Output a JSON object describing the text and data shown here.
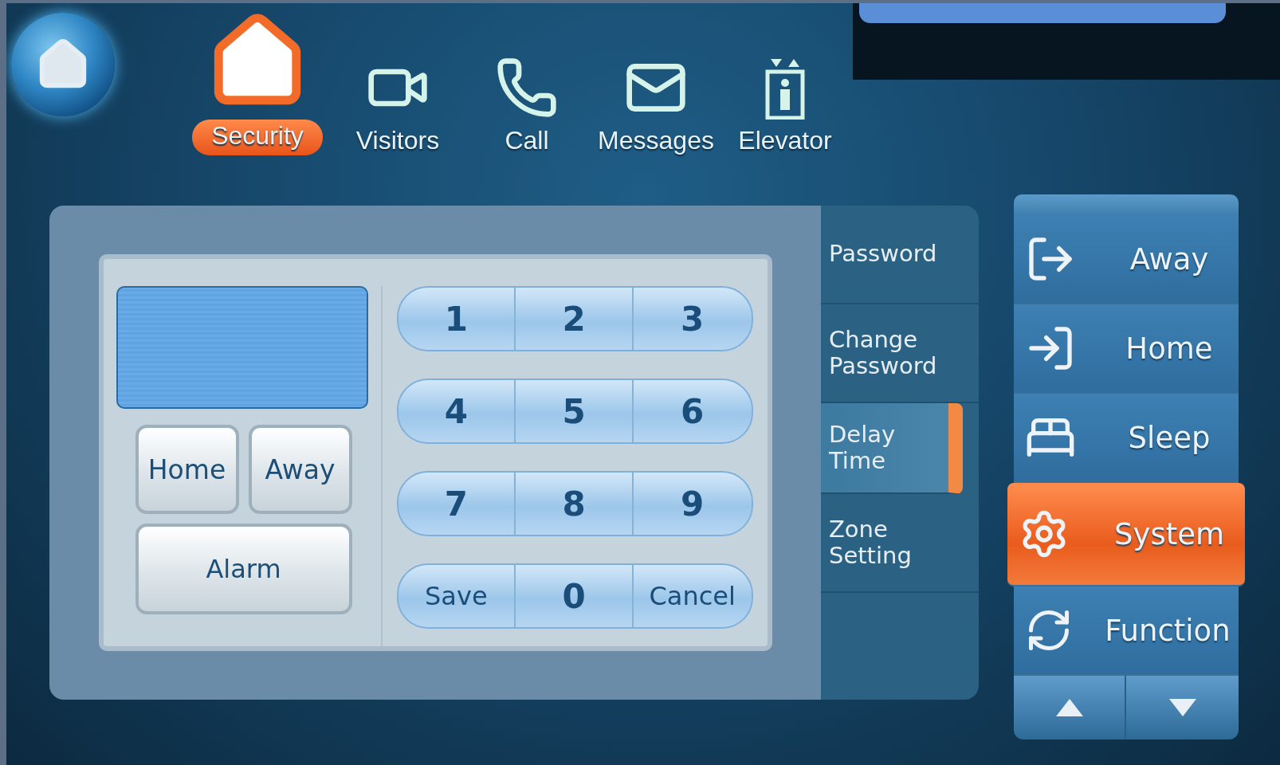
{
  "nav": [
    {
      "label": "Security",
      "selected": true
    },
    {
      "label": "Visitors",
      "selected": false
    },
    {
      "label": "Call",
      "selected": false
    },
    {
      "label": "Messages",
      "selected": false
    },
    {
      "label": "Elevator",
      "selected": false
    }
  ],
  "mode_buttons": [
    {
      "label": "Home"
    },
    {
      "label": "Away"
    },
    {
      "label": "Alarm"
    }
  ],
  "keypad": [
    [
      {
        "label": "1",
        "kind": "digit"
      },
      {
        "label": "2",
        "kind": "digit"
      },
      {
        "label": "3",
        "kind": "digit"
      }
    ],
    [
      {
        "label": "4",
        "kind": "digit"
      },
      {
        "label": "5",
        "kind": "digit"
      },
      {
        "label": "6",
        "kind": "digit"
      }
    ],
    [
      {
        "label": "7",
        "kind": "digit"
      },
      {
        "label": "8",
        "kind": "digit"
      },
      {
        "label": "9",
        "kind": "digit"
      }
    ],
    [
      {
        "label": "Save",
        "kind": "action"
      },
      {
        "label": "0",
        "kind": "digit"
      },
      {
        "label": "Cancel",
        "kind": "action"
      }
    ]
  ],
  "submenu": [
    {
      "label": "Password",
      "selected": false
    },
    {
      "label": "Change\nPassword",
      "selected": false
    },
    {
      "label": "Delay\nTime",
      "selected": true
    },
    {
      "label": "Zone\nSetting",
      "selected": false
    }
  ],
  "modes": [
    {
      "label": "Away",
      "selected": false
    },
    {
      "label": "Home",
      "selected": false
    },
    {
      "label": "Sleep",
      "selected": false
    },
    {
      "label": "System",
      "selected": true
    },
    {
      "label": "Function",
      "selected": false
    }
  ]
}
